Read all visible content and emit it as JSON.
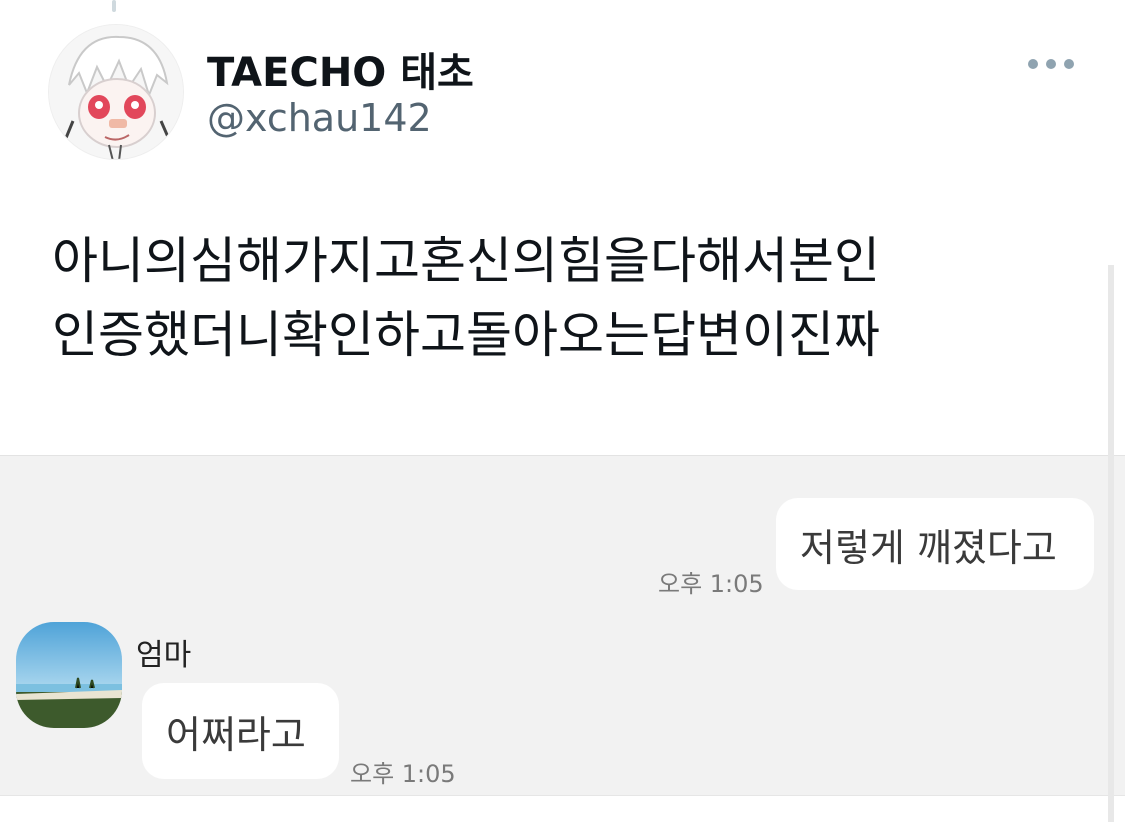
{
  "tweet": {
    "display_name": "TAECHO 태초",
    "handle": "@xchau142",
    "more_icon": "more-horizontal-icon",
    "text_lines": [
      "아니의심해가지고혼신의힘을다해서본인",
      "인증했더니확인하고돌아오는답변이진짜"
    ]
  },
  "chat": {
    "sent": {
      "text": "저렇게 깨졌다고",
      "time": "오후 1:05"
    },
    "received": {
      "sender": "엄마",
      "text": "어쩌라고",
      "time": "오후 1:05"
    }
  },
  "colors": {
    "handle": "#536471",
    "chat_background": "#f2f2f2",
    "bubble": "#ffffff",
    "more_dots": "#8fa3b0"
  }
}
